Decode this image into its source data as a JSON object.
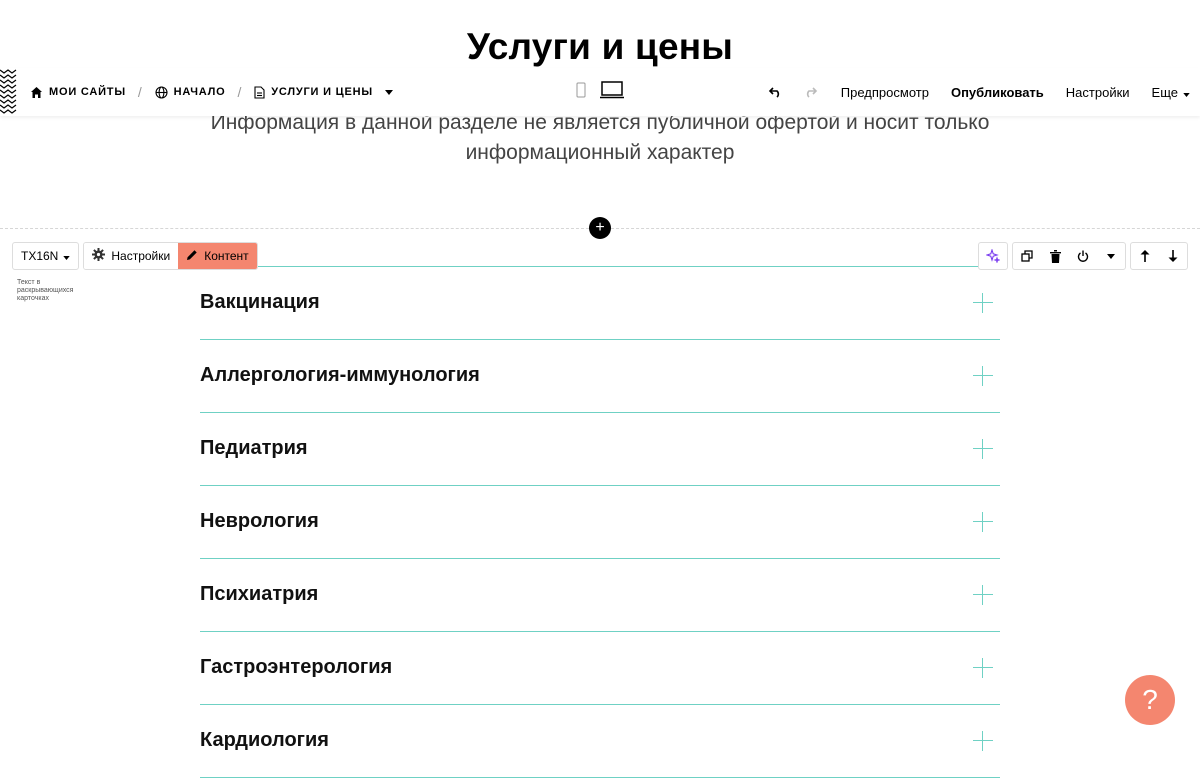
{
  "page": {
    "title": "Услуги и цены",
    "subtitle": "Информация в данной разделе не является публичной офертой и носит только информационный характер"
  },
  "toolbar": {
    "breadcrumbs": [
      {
        "label": "Мои сайты",
        "icon": "home-icon"
      },
      {
        "label": "Начало",
        "icon": "globe-icon"
      },
      {
        "label": "Услуги и цены",
        "icon": "page-icon"
      }
    ],
    "separator": "/",
    "preview_label": "Предпросмотр",
    "publish_label": "Опубликовать",
    "settings_label": "Настройки",
    "more_label": "Еще"
  },
  "block": {
    "type_label": "TX16N",
    "settings_label": "Настройки",
    "content_label": "Контент",
    "description": "Текст в раскрывающихся карточках",
    "accent_color": "#f4866f"
  },
  "accordion": {
    "line_color": "#6fd1c4",
    "items": [
      {
        "title": "Вакцинация"
      },
      {
        "title": "Аллергология-иммунология"
      },
      {
        "title": "Педиатрия"
      },
      {
        "title": "Неврология"
      },
      {
        "title": "Психиатрия"
      },
      {
        "title": "Гастроэнтерология"
      },
      {
        "title": "Кардиология"
      }
    ]
  },
  "help": {
    "label": "?"
  }
}
